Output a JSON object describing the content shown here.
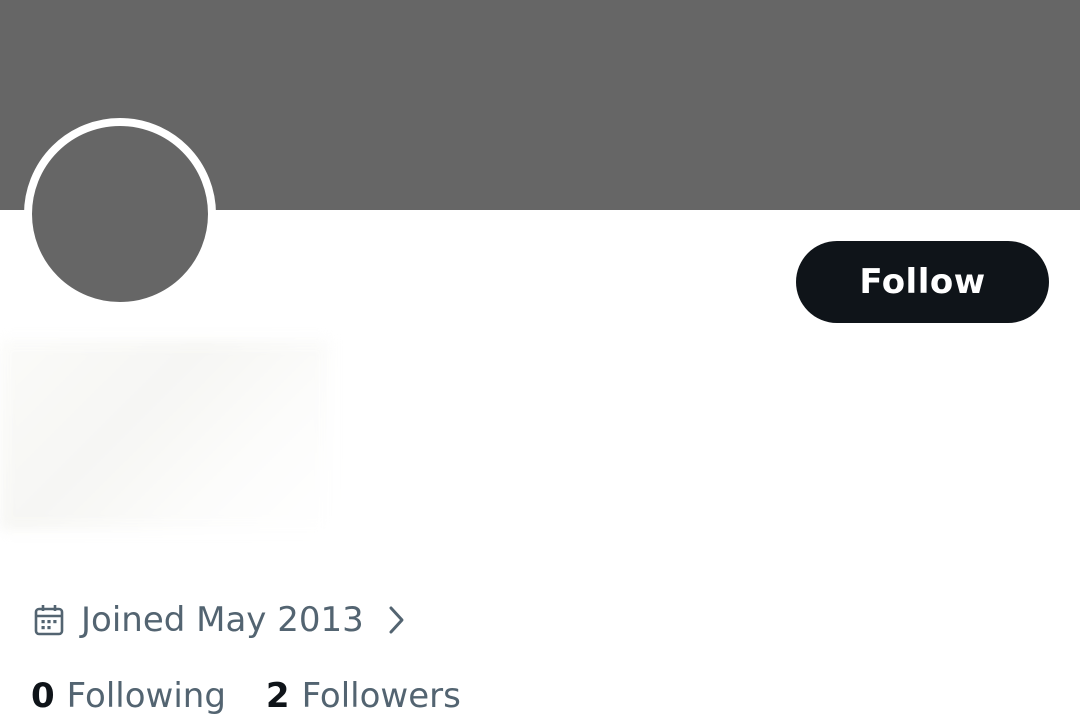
{
  "profile": {
    "follow_label": "Follow",
    "joined": "Joined May 2013",
    "following_count": "0",
    "following_label": "Following",
    "followers_count": "2",
    "followers_label": "Followers"
  },
  "icons": {
    "calendar": "calendar-icon",
    "chevron": "chevron-right-icon"
  },
  "colors": {
    "banner": "#666666",
    "avatar": "#666666",
    "follow_button_bg": "#0f1419",
    "follow_button_text": "#ffffff",
    "secondary_text": "#536471",
    "primary_text": "#0f1419"
  }
}
